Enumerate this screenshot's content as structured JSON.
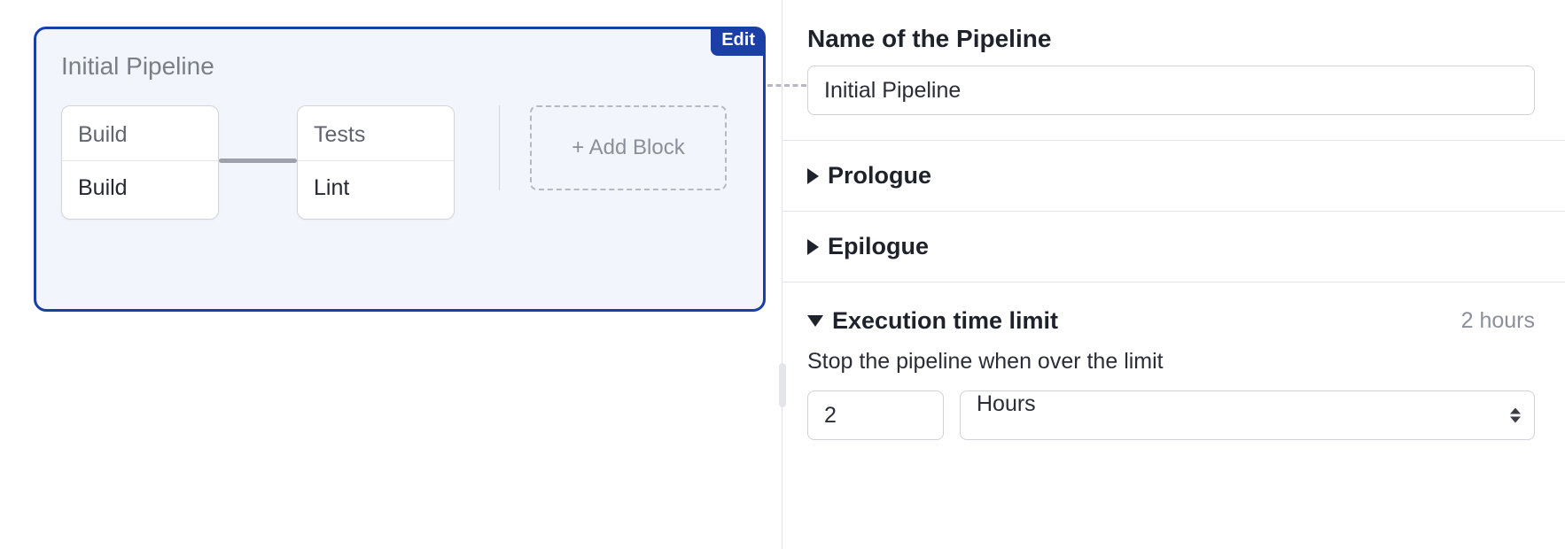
{
  "pipeline": {
    "title": "Initial Pipeline",
    "edit_label": "Edit",
    "blocks": [
      {
        "name": "Build",
        "job": "Build"
      },
      {
        "name": "Tests",
        "job": "Lint"
      }
    ],
    "add_block_label": "+ Add Block"
  },
  "panel": {
    "name_label": "Name of the Pipeline",
    "name_value": "Initial Pipeline",
    "prologue_label": "Prologue",
    "epilogue_label": "Epilogue",
    "exec_limit": {
      "label": "Execution time limit",
      "summary": "2 hours",
      "description": "Stop the pipeline when over the limit",
      "value": "2",
      "unit": "Hours"
    }
  }
}
